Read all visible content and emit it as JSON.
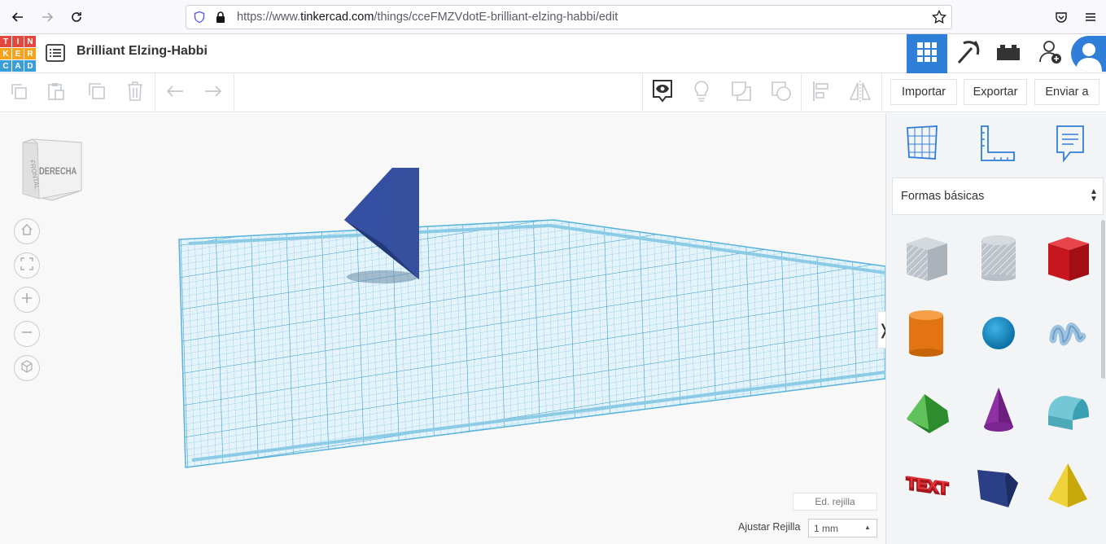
{
  "browser": {
    "url_prefix": "https://www.",
    "url_domain": "tinkercad.com",
    "url_path": "/things/cceFMZVdotE-brilliant-elzing-habbi/edit"
  },
  "logo": {
    "letters": [
      "T",
      "I",
      "N",
      "K",
      "E",
      "R",
      "C",
      "A",
      "D"
    ],
    "colors": [
      "#e2483d",
      "#e2483d",
      "#e2483d",
      "#f7a21b",
      "#f7a21b",
      "#f7a21b",
      "#3a9fd8",
      "#3a9fd8",
      "#3a9fd8"
    ]
  },
  "header": {
    "title": "Brilliant Elzing-Habbi",
    "accent": "#2f7ed8"
  },
  "toolbar": {
    "import_label": "Importar",
    "export_label": "Exportar",
    "send_label": "Enviar a"
  },
  "viewcube": {
    "front_label": "DERECHA",
    "side_label": "FRONTAL"
  },
  "panel": {
    "category": "Formas básicas",
    "shapes": [
      {
        "name": "box-hole",
        "color": "#b7bec5"
      },
      {
        "name": "cylinder-hole",
        "color": "#c4c9cf"
      },
      {
        "name": "box",
        "color": "#d4202a"
      },
      {
        "name": "cylinder",
        "color": "#e87d19"
      },
      {
        "name": "sphere",
        "color": "#1791c9"
      },
      {
        "name": "scribble",
        "color": "#8fb8da"
      },
      {
        "name": "roof",
        "color": "#3aa23b"
      },
      {
        "name": "cone",
        "color": "#8a2d9e"
      },
      {
        "name": "round-roof",
        "color": "#5ab7c7"
      },
      {
        "name": "text",
        "color": "#d0262b"
      },
      {
        "name": "polygon",
        "color": "#26397a"
      },
      {
        "name": "pyramid",
        "color": "#e8c712"
      }
    ]
  },
  "grid": {
    "edit_label": "Ed. rejilla",
    "adjust_label": "Ajustar Rejilla",
    "snap_value": "1 mm"
  }
}
